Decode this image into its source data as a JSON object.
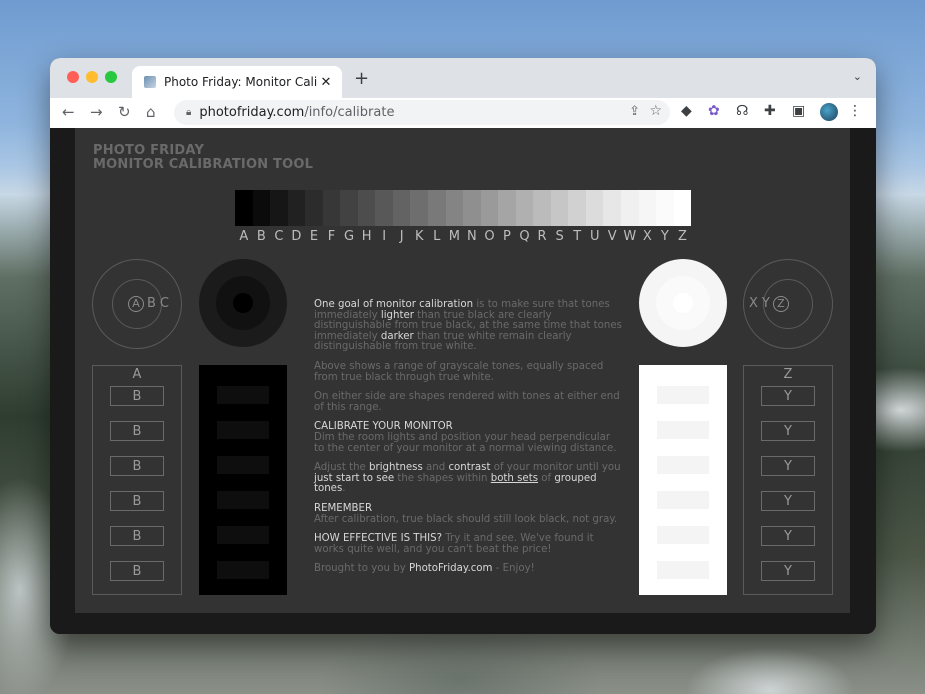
{
  "browser": {
    "tab_title": "Photo Friday: Monitor Calibratio",
    "tab_close": "✕",
    "new_tab": "+",
    "url_host": "photofriday.com",
    "url_path": "/info/calibrate"
  },
  "page": {
    "heading_line1": "PHOTO FRIDAY",
    "heading_line2": "MONITOR CALIBRATION TOOL",
    "ramp_letters": [
      "A",
      "B",
      "C",
      "D",
      "E",
      "F",
      "G",
      "H",
      "I",
      "J",
      "K",
      "L",
      "M",
      "N",
      "O",
      "P",
      "Q",
      "R",
      "S",
      "T",
      "U",
      "V",
      "W",
      "X",
      "Y",
      "Z"
    ],
    "ramp_colors": [
      "#000000",
      "#0b0b0b",
      "#161616",
      "#212121",
      "#2c2c2c",
      "#373737",
      "#424242",
      "#4d4d4d",
      "#585858",
      "#636363",
      "#6e6e6e",
      "#797979",
      "#848484",
      "#8f8f8f",
      "#9a9a9a",
      "#a5a5a5",
      "#b0b0b0",
      "#bbbbbb",
      "#c6c6c6",
      "#d1d1d1",
      "#dcdcdc",
      "#e7e7e7",
      "#f0f0f0",
      "#f6f6f6",
      "#fbfbfb",
      "#ffffff"
    ],
    "left_ring_letters": [
      "A",
      "B",
      "C"
    ],
    "right_ring_letters": [
      "X",
      "Y",
      "Z"
    ],
    "left_col_title": "A",
    "left_cells": [
      "B",
      "B",
      "B",
      "B",
      "B",
      "B"
    ],
    "right_col_title": "Z",
    "right_cells": [
      "Y",
      "Y",
      "Y",
      "Y",
      "Y",
      "Y"
    ],
    "text": {
      "p1_hl1": "One goal of monitor calibration",
      "p1_t1": " is to make sure that tones immediately ",
      "p1_hl2": "lighter",
      "p1_t2": " than true black are clearly distinguishable from true black, at the same time that tones immediately ",
      "p1_hl3": "darker",
      "p1_t3": " than true white remain clearly distinguishable from true white.",
      "p2": "Above shows a range of grayscale tones, equally spaced from true black through true white.",
      "p3": "On either side are shapes rendered with tones at either end of this range.",
      "p4_hl": "CALIBRATE YOUR MONITOR",
      "p4_t": "Dim the room lights and position your head perpendicular to the center of your monitor at a normal viewing distance.",
      "p5_t1": "Adjust the ",
      "p5_hl1": "brightness",
      "p5_t2": " and ",
      "p5_hl2": "contrast",
      "p5_t3": " of your monitor until you ",
      "p5_hl3": "just start to see",
      "p5_t4": " the shapes within ",
      "p5_hl4": "both sets",
      "p5_t5": " of ",
      "p5_hl5": "grouped tones",
      "p5_t6": ".",
      "p6_hl": "REMEMBER",
      "p6_t": "After calibration, true black should still look black, not gray.",
      "p7_hl": "HOW EFFECTIVE IS THIS?",
      "p7_t": "  Try it and see.  We've found it works quite well, and you can't beat the price!",
      "p8_t1": "Brought to you by ",
      "p8_hl": "PhotoFriday.com",
      "p8_t2": " - Enjoy!"
    }
  }
}
